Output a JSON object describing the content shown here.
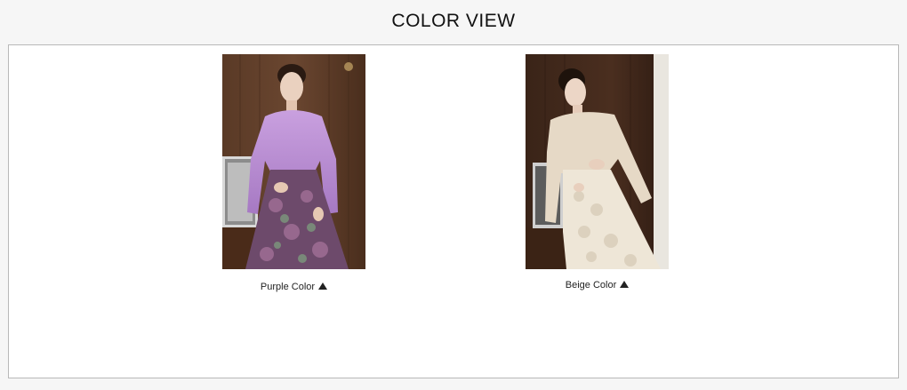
{
  "header": {
    "title": "COLOR VIEW"
  },
  "variants": [
    {
      "label": "Purple Color",
      "top_color": "#b98ad1",
      "skirt_color": "#6f4a6c"
    },
    {
      "label": "Beige Color",
      "top_color": "#e7dccb",
      "skirt_color": "#efe7d8"
    }
  ],
  "colors": {
    "background": "#f6f6f6",
    "frame_border": "#b8b8b8",
    "frame_fill": "#ffffff"
  }
}
